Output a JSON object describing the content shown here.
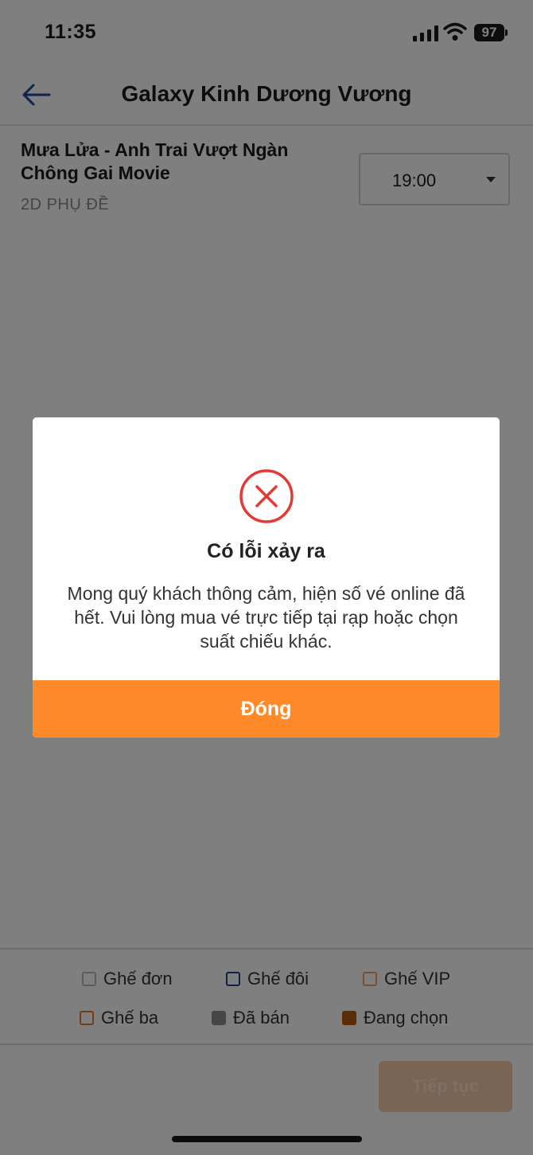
{
  "status_bar": {
    "time": "11:35",
    "battery": "97",
    "icons": [
      "signal-icon",
      "wifi-icon",
      "battery-icon"
    ]
  },
  "header": {
    "back_icon": "back-arrow-icon",
    "title": "Galaxy Kinh Dương Vương"
  },
  "movie": {
    "title": "Mưa Lửa - Anh Trai Vượt Ngàn Chông Gai Movie",
    "format": "2D PHỤ ĐỀ",
    "showtime": "19:00"
  },
  "legend": {
    "single": "Ghế đơn",
    "double": "Ghế đôi",
    "vip": "Ghế VIP",
    "triple": "Ghế ba",
    "sold": "Đã bán",
    "selecting": "Đang chọn"
  },
  "bottom": {
    "continue_label": "Tiếp tục"
  },
  "modal": {
    "icon": "error-x-icon",
    "title": "Có lỗi xảy ra",
    "message": "Mong quý khách thông cảm, hiện số vé online đã hết. Vui lòng mua vé trực tiếp tại rạp hoặc chọn suất chiếu khác.",
    "close_label": "Đóng"
  },
  "colors": {
    "accent": "#ff8a2a",
    "error": "#e53935",
    "single_seat": "#b9b9b9",
    "double_seat": "#1f3f8f",
    "vip_seat": "#f0a05a",
    "triple_seat": "#e8782a",
    "sold_seat": "#8e8e8e",
    "selecting_seat": "#b35a10"
  }
}
